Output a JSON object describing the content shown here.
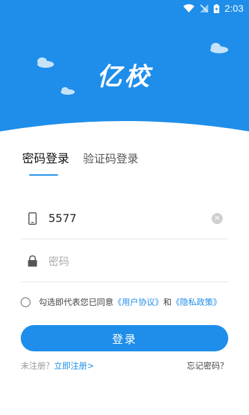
{
  "status_bar": {
    "time": "2:03"
  },
  "header": {
    "logo_text": "亿校",
    "color": "#1E8EEA"
  },
  "tabs": [
    {
      "label": "密码登录",
      "active": true
    },
    {
      "label": "验证码登录",
      "active": false
    }
  ],
  "phone_field": {
    "value": "5577",
    "icon": "phone-icon"
  },
  "password_field": {
    "placeholder": "密码",
    "icon": "lock-icon"
  },
  "agreement": {
    "prefix": "勾选即代表您已同意",
    "user_agreement": "《用户协议》",
    "conjunction": "和",
    "privacy_policy": "《隐私政策》"
  },
  "login_button": {
    "label": "登录"
  },
  "footer": {
    "not_registered": "未注册？",
    "register_link": "立即注册>",
    "forgot_password": "忘记密码？"
  }
}
